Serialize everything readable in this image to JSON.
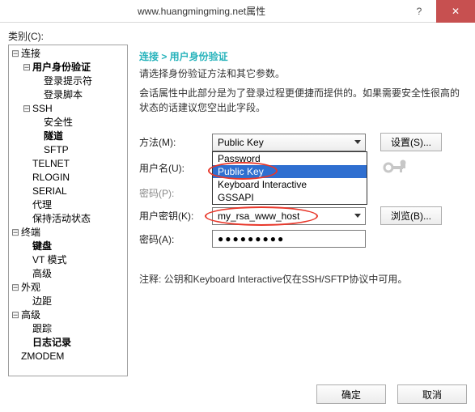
{
  "window": {
    "title": "www.huangmingming.net属性",
    "help": "?",
    "close": "✕"
  },
  "category_label": "类别(C):",
  "tree": {
    "n0": "连接",
    "n0_0": "用户身份验证",
    "n0_0_0": "登录提示符",
    "n0_0_1": "登录脚本",
    "n0_1": "SSH",
    "n0_1_0": "安全性",
    "n0_1_1": "隧道",
    "n0_1_2": "SFTP",
    "n0_2": "TELNET",
    "n0_3": "RLOGIN",
    "n0_4": "SERIAL",
    "n0_5": "代理",
    "n0_6": "保持活动状态",
    "n1": "终端",
    "n1_0": "键盘",
    "n1_1": "VT 模式",
    "n1_2": "高级",
    "n2": "外观",
    "n2_0": "边距",
    "n3": "高级",
    "n3_0": "跟踪",
    "n3_1": "日志记录",
    "n4": "ZMODEM"
  },
  "right": {
    "breadcrumb": "连接 > 用户身份验证",
    "intro": "请选择身份验证方法和其它参数。",
    "desc": "会话属性中此部分是为了登录过程更便捷而提供的。如果需要安全性很高的状态的话建议您空出此字段。",
    "method_label": "方法(M):",
    "method_value": "Public Key",
    "method_options": {
      "o0": "Password",
      "o1": "Public Key",
      "o2": "Keyboard Interactive",
      "o3": "GSSAPI"
    },
    "setup_btn": "设置(S)...",
    "user_label": "用户名(U):",
    "pwd_label": "密码(P):",
    "userkey_label": "用户密钥(K):",
    "userkey_value": "my_rsa_www_host",
    "browse_btn": "浏览(B)...",
    "passphrase_label": "密码(A):",
    "passphrase_value": "●●●●●●●●●",
    "note": "注释: 公钥和Keyboard Interactive仅在SSH/SFTP协议中可用。"
  },
  "footer": {
    "ok": "确定",
    "cancel": "取消"
  }
}
